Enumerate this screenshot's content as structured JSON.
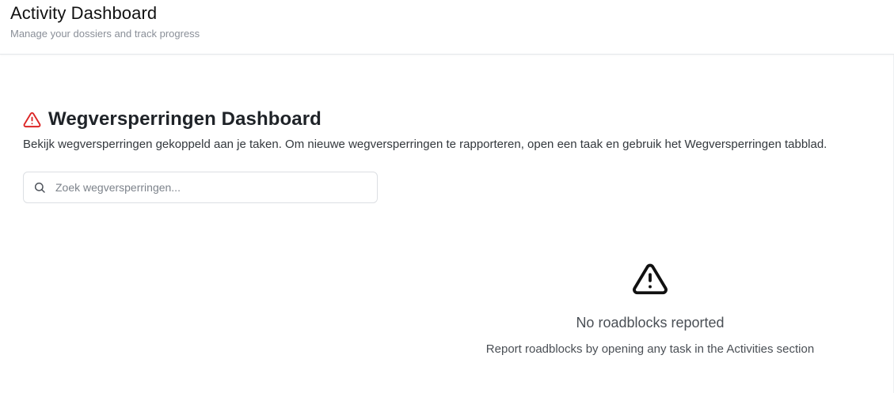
{
  "header": {
    "title": "Activity Dashboard",
    "subtitle": "Manage your dossiers and track progress"
  },
  "section": {
    "icon": "warning-triangle-icon",
    "title": "Wegversperringen Dashboard",
    "description": "Bekijk wegversperringen gekoppeld aan je taken. Om nieuwe wegversperringen te rapporteren, open een taak en gebruik het Wegversperringen tabblad."
  },
  "search": {
    "icon": "search-icon",
    "placeholder": "Zoek wegversperringen...",
    "value": ""
  },
  "empty_state": {
    "icon": "warning-triangle-icon",
    "title": "No roadblocks reported",
    "hint": "Report roadblocks by opening any task in the Activities section"
  },
  "colors": {
    "accent_warning": "#dc2626",
    "text_primary": "#1f2328",
    "text_muted": "#8a8f98",
    "border": "#dcdfe3"
  }
}
